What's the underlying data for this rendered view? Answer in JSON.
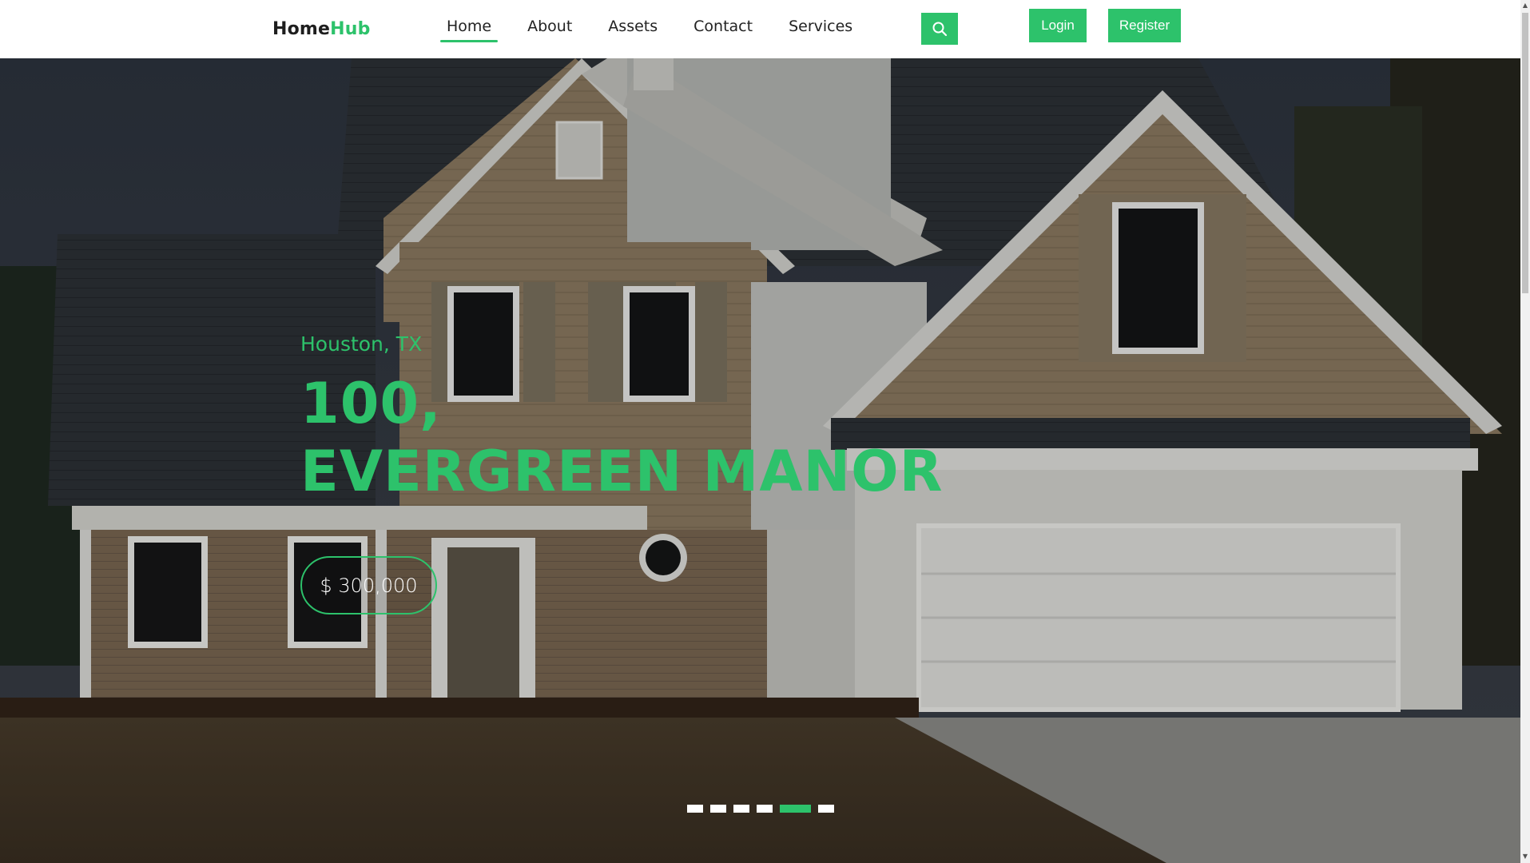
{
  "brand": {
    "name_part1": "Home",
    "name_part2": "Hub",
    "accent_color": "#2dc26b"
  },
  "nav": {
    "items": [
      {
        "label": "Home",
        "active": true
      },
      {
        "label": "About",
        "active": false
      },
      {
        "label": "Assets",
        "active": false
      },
      {
        "label": "Contact",
        "active": false
      },
      {
        "label": "Services",
        "active": false
      }
    ]
  },
  "header": {
    "search_icon": "search-icon",
    "login_label": "Login",
    "register_label": "Register"
  },
  "hero": {
    "location": "Houston, TX",
    "title_line1": "100,",
    "title_line2": "EVERGREEN MANOR",
    "price": "$ 300,000",
    "slides_total": 6,
    "active_slide": 5
  }
}
